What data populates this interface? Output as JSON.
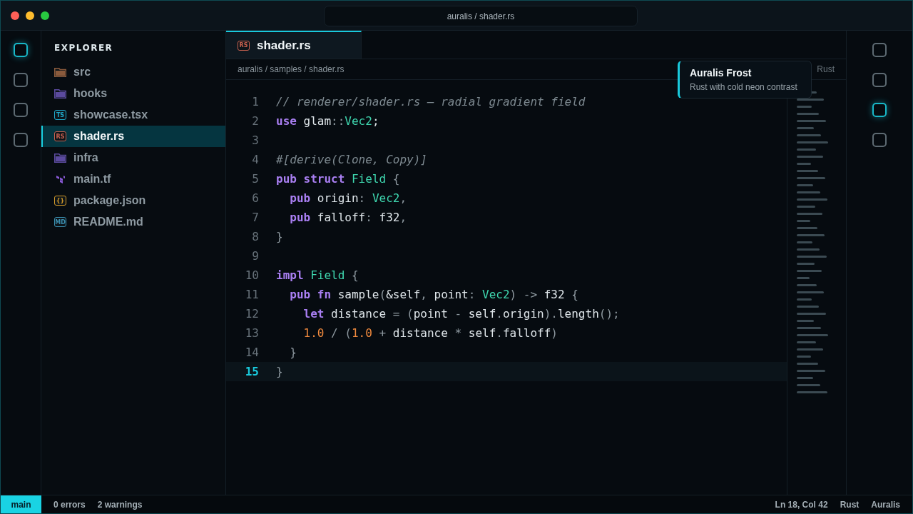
{
  "window": {
    "title": "auralis / shader.rs"
  },
  "activity_left": [
    {
      "selected": true
    },
    {
      "selected": false
    },
    {
      "selected": false
    },
    {
      "selected": false
    }
  ],
  "activity_right": [
    {
      "selected": false
    },
    {
      "selected": false
    },
    {
      "selected": true
    },
    {
      "selected": false
    }
  ],
  "explorer": {
    "title": "EXPLORER",
    "items": [
      {
        "name": "src",
        "kind": "folder",
        "color": "#8a5a3c",
        "selected": false
      },
      {
        "name": "hooks",
        "kind": "folder",
        "color": "#5b4a9e",
        "selected": false
      },
      {
        "name": "showcase.tsx",
        "kind": "badge",
        "badge": "TS",
        "color": "#1fa8c9",
        "selected": false
      },
      {
        "name": "shader.rs",
        "kind": "badge",
        "badge": "RS",
        "color": "#c8614f",
        "selected": true
      },
      {
        "name": "infra",
        "kind": "folder",
        "color": "#5b4a9e",
        "selected": false
      },
      {
        "name": "main.tf",
        "kind": "terraform",
        "color": "#8a5ad8",
        "selected": false
      },
      {
        "name": "package.json",
        "kind": "badge",
        "badge": "{}",
        "color": "#d49a2a",
        "selected": false
      },
      {
        "name": "README.md",
        "kind": "badge",
        "badge": "MD",
        "color": "#3b8fb0",
        "selected": false
      }
    ]
  },
  "tabs": [
    {
      "label": "shader.rs",
      "badge": "RS",
      "selected": true
    }
  ],
  "breadcrumb": "auralis / samples / shader.rs",
  "breadcrumb_language": "Rust",
  "tooltip": {
    "title": "Auralis Frost",
    "subtitle": "Rust with cold neon contrast"
  },
  "code": {
    "lines": [
      {
        "number": "1",
        "current": false,
        "tokens": [
          {
            "kind": "comment",
            "text": "// renderer/shader.rs — radial gradient field"
          }
        ]
      },
      {
        "number": "2",
        "current": false,
        "tokens": [
          {
            "kind": "kw",
            "text": "use"
          },
          {
            "kind": "plain",
            "text": " glam"
          },
          {
            "kind": "punct",
            "text": "::"
          },
          {
            "kind": "type",
            "text": "Vec2"
          },
          {
            "kind": "plain",
            "text": ";"
          }
        ]
      },
      {
        "number": "3",
        "current": false
      },
      {
        "number": "4",
        "current": false,
        "tokens": [
          {
            "kind": "comment",
            "text": "#[derive(Clone, Copy)]"
          }
        ]
      },
      {
        "number": "5",
        "current": false,
        "tokens": [
          {
            "kind": "kw",
            "text": "pub struct"
          },
          {
            "kind": "type",
            "text": " Field"
          },
          {
            "kind": "punct",
            "text": " {"
          }
        ]
      },
      {
        "number": "6",
        "current": false,
        "tokens": [
          {
            "kind": "kw",
            "text": "  pub"
          },
          {
            "kind": "plain",
            "text": " origin"
          },
          {
            "kind": "punct",
            "text": ": "
          },
          {
            "kind": "type",
            "text": "Vec2"
          },
          {
            "kind": "punct",
            "text": ","
          }
        ]
      },
      {
        "number": "7",
        "current": false,
        "tokens": [
          {
            "kind": "kw",
            "text": "  pub"
          },
          {
            "kind": "plain",
            "text": " falloff"
          },
          {
            "kind": "punct",
            "text": ": "
          },
          {
            "kind": "plain",
            "text": "f32"
          },
          {
            "kind": "punct",
            "text": ","
          }
        ]
      },
      {
        "number": "8",
        "current": false,
        "tokens": [
          {
            "kind": "punct",
            "text": "}"
          }
        ]
      },
      {
        "number": "9",
        "current": false
      },
      {
        "number": "10",
        "current": false,
        "tokens": [
          {
            "kind": "kw",
            "text": "impl"
          },
          {
            "kind": "type",
            "text": " Field"
          },
          {
            "kind": "punct",
            "text": " {"
          }
        ]
      },
      {
        "number": "11",
        "current": false,
        "tokens": [
          {
            "kind": "kw",
            "text": "  pub fn"
          },
          {
            "kind": "plain",
            "text": " sample"
          },
          {
            "kind": "punct",
            "text": "("
          },
          {
            "kind": "plain",
            "text": "&self"
          },
          {
            "kind": "punct",
            "text": ", "
          },
          {
            "kind": "plain",
            "text": "point"
          },
          {
            "kind": "punct",
            "text": ": "
          },
          {
            "kind": "type",
            "text": "Vec2"
          },
          {
            "kind": "punct",
            "text": ") -> "
          },
          {
            "kind": "plain",
            "text": "f32"
          },
          {
            "kind": "punct",
            "text": " {"
          }
        ]
      },
      {
        "number": "12",
        "current": false,
        "tokens": [
          {
            "kind": "kw",
            "text": "    let"
          },
          {
            "kind": "plain",
            "text": " distance "
          },
          {
            "kind": "punct",
            "text": "= ("
          },
          {
            "kind": "plain",
            "text": "point "
          },
          {
            "kind": "punct",
            "text": "- "
          },
          {
            "kind": "plain",
            "text": "self"
          },
          {
            "kind": "punct",
            "text": "."
          },
          {
            "kind": "plain",
            "text": "origin"
          },
          {
            "kind": "punct",
            "text": ")."
          },
          {
            "kind": "plain",
            "text": "length"
          },
          {
            "kind": "punct",
            "text": "();"
          }
        ]
      },
      {
        "number": "13",
        "current": false,
        "tokens": [
          {
            "kind": "num",
            "text": "    1.0"
          },
          {
            "kind": "punct",
            "text": " / ("
          },
          {
            "kind": "num",
            "text": "1.0"
          },
          {
            "kind": "punct",
            "text": " + "
          },
          {
            "kind": "plain",
            "text": "distance "
          },
          {
            "kind": "punct",
            "text": "* "
          },
          {
            "kind": "plain",
            "text": "self"
          },
          {
            "kind": "punct",
            "text": "."
          },
          {
            "kind": "plain",
            "text": "falloff"
          },
          {
            "kind": "punct",
            "text": ")"
          }
        ]
      },
      {
        "number": "14",
        "current": false,
        "tokens": [
          {
            "kind": "punct",
            "text": "  }"
          }
        ]
      },
      {
        "number": "15",
        "current": true,
        "tokens": [
          {
            "kind": "punct",
            "text": "}"
          }
        ]
      }
    ]
  },
  "status_bar": {
    "branch": "main",
    "errors": "0 errors",
    "warnings": "2 warnings",
    "position": "Ln 18, Col 42",
    "language": "Rust",
    "theme": "Auralis"
  }
}
